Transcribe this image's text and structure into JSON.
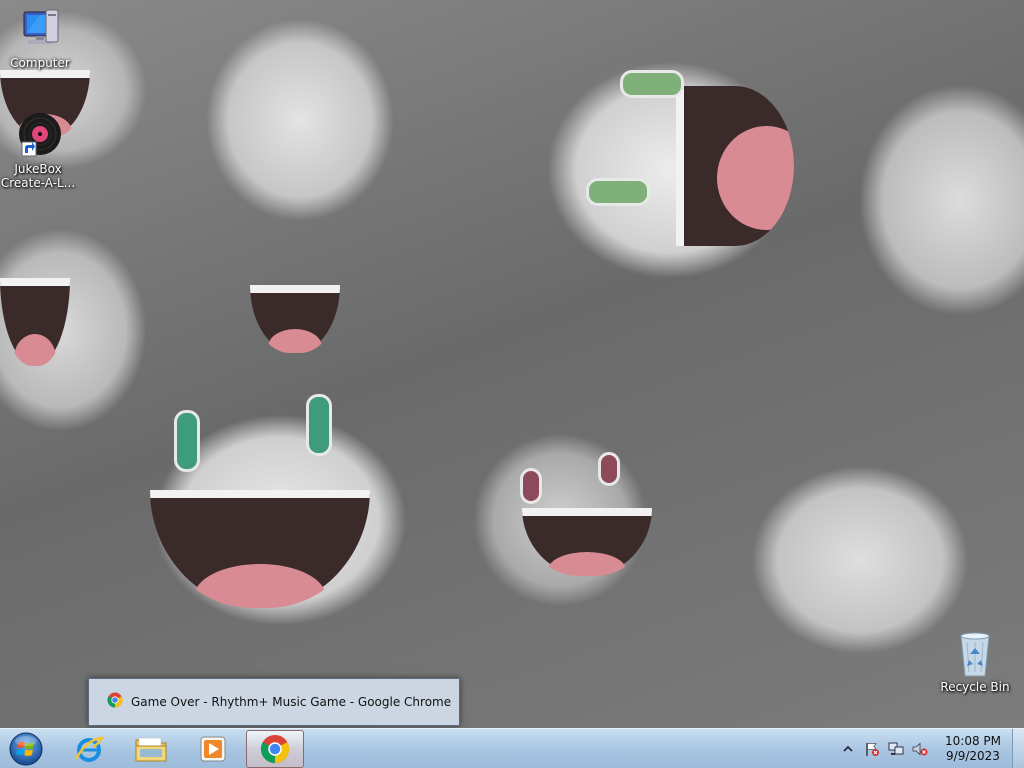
{
  "desktop": {
    "icons": [
      {
        "label": "Computer"
      },
      {
        "label": "JukeBox Create-A-L..."
      },
      {
        "label": "Recycle Bin"
      }
    ]
  },
  "thumbnail": {
    "title": "Game Over - Rhythm+ Music Game - Google Chrome"
  },
  "taskbar": {
    "start_icon": "windows-orb-icon",
    "pinned": [
      {
        "name": "internet-explorer-icon"
      },
      {
        "name": "file-explorer-icon"
      },
      {
        "name": "media-player-icon"
      },
      {
        "name": "chrome-icon",
        "active": true
      }
    ],
    "tray": {
      "icons": [
        "show-hidden-icons-chevron",
        "action-center-flag-icon",
        "network-icon",
        "volume-muted-icon"
      ],
      "time": "10:08 PM",
      "date": "9/9/2023"
    }
  },
  "colors": {
    "taskbar": "#a9c6e2",
    "active_button": "#e6d2d2",
    "chrome_red": "#db4437",
    "chrome_yellow": "#f4c20d",
    "chrome_green": "#0f9d58",
    "chrome_blue": "#4285f4"
  }
}
